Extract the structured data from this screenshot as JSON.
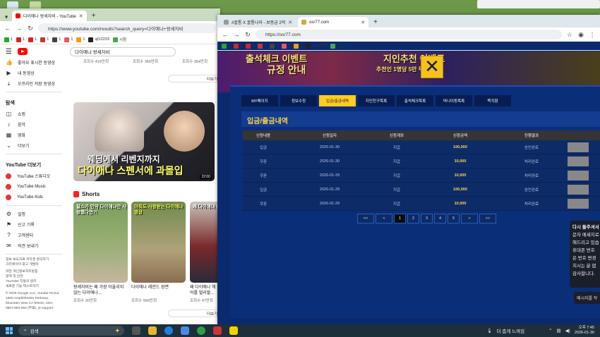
{
  "left_browser": {
    "tab_title": "다이애나 왕세자비 - YouTube",
    "url": "https://www.youtube.com/results?search_query=다이애나+왕세자비",
    "bookmarks": [
      "1",
      "1",
      "1",
      "1",
      "1",
      "1",
      "1",
      "1",
      "sjl12233",
      "시청"
    ],
    "search_text": "다이애나 왕세자비",
    "top_views": [
      "조회수 416만회",
      "조회수 366만회",
      "조회수 364만회"
    ],
    "more_label": "더보기",
    "sidebar": {
      "items_top": [
        "좋아요 표시한 동영상",
        "내 동영상",
        "오프라인 저장 동영상"
      ],
      "explore_title": "탐색",
      "explore": [
        "쇼핑",
        "음악",
        "영화",
        "더보기"
      ],
      "more_title": "YouTube 더보기",
      "more": [
        "YouTube 스튜디오",
        "YouTube Music",
        "YouTube Kids"
      ],
      "settings": [
        "설정",
        "신고 기록",
        "고객센터",
        "의견 보내기"
      ],
      "footer": [
        "정보 보도자료 저작권 문의하기",
        "크리에이터 광고 개발자",
        "약관 개인정보처리방침",
        "정책 및 안전",
        "YouTube 작동의 원리",
        "새로운 기능 테스트하기",
        "© 2026 Google LLC, Sundar Pichai,",
        "1600 Amphitheatre Parkway,",
        "Mountain View CA 94043, USA,",
        "0807-882-594 (무료), yt-support-"
      ]
    },
    "video": {
      "thumb_line1": "웨딩에서 리벤지까지",
      "thumb_line2": "다이애나 스펜서에 과몰입",
      "duration": "22:00"
    },
    "shorts_title": "Shorts",
    "shorts": [
      {
        "cap": "찰스가 만약 다이애나만 사랑했다면?!",
        "title": "왕세자비는 왜 가장 어울리지 않는 다이애나...",
        "views": "조회수 30만회"
      },
      {
        "cap": "아직도 사랑받는 다이애나 영상",
        "title": "다이애나 레전드 장면",
        "views": "조회수 566만회"
      },
      {
        "cap": "왜 다이애나 헤어를",
        "title": "왜 다이애나 헤어를 멀리할...",
        "views": "조회수 47만회"
      }
    ]
  },
  "right_browser": {
    "tab1_title": "#꿀통 X 꿀통나라 - 보증금 2억",
    "tab2_title": "osr77.com",
    "url": "https://osr77.com",
    "bookmarks": [
      "1",
      "1",
      "1",
      "1",
      "1",
      "1",
      "1",
      "1",
      "sjl12233",
      "시청"
    ],
    "banner": [
      "출석체크 이벤트",
      "규정 안내",
      "지인추천 이벤트",
      "추천인 1명당 5만 무제한!"
    ],
    "menu": [
      "MY페이지",
      "정보수정",
      "입금/출금내역",
      "지인친구목록",
      "출석체크목록",
      "머니이동목록",
      "쪽지함"
    ],
    "active_menu": "입금/출금내역",
    "page_title": "입금/출금내역",
    "table": {
      "headers": [
        "신청내용",
        "신청일자",
        "신청계좌",
        "신청금액",
        "진행결과"
      ],
      "rows": [
        [
          "입금",
          "2026-01-30",
          "지갑",
          "100,000",
          "승인완료"
        ],
        [
          "쿠폰",
          "2026-01-30",
          "지갑",
          "10,000",
          "처리완료"
        ],
        [
          "쿠폰",
          "2026-01-29",
          "지갑",
          "10,000",
          "처리완료"
        ],
        [
          "입금",
          "2026-01-29",
          "지갑",
          "100,000",
          "승인완료"
        ],
        [
          "쿠폰",
          "2026-01-29",
          "지갑",
          "10,000",
          "처리완료"
        ]
      ]
    },
    "pager": [
      "<<",
      "<",
      "1",
      "2",
      "3",
      "4",
      "5",
      ">",
      ">>"
    ],
    "current_page": "1",
    "chat_popup": [
      "다시 돌주셔서",
      "문자 메세지로",
      "해드리고 있습",
      "",
      "휴대폰 번호",
      "은 번호 변경",
      "치시는 분 없",
      "",
      "감사합니다."
    ],
    "chat_button": "메시지를 작"
  },
  "taskbar": {
    "search": "검색",
    "tray_text": "더 춥게 느껴짐",
    "time": "오후 7:45",
    "date": "2026-01-30"
  }
}
